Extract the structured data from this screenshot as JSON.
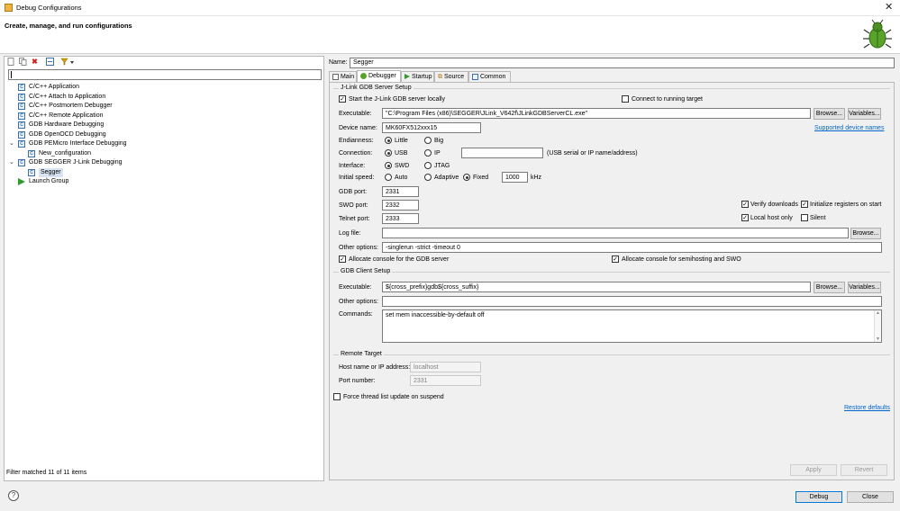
{
  "window": {
    "title": "Debug Configurations",
    "close_icon": "✕"
  },
  "banner": {
    "heading": "Create, manage, and run configurations"
  },
  "left": {
    "toolbar": [
      "new-configuration-icon",
      "duplicate-icon",
      "delete-icon",
      "collapse-all-icon",
      "filter-icon"
    ],
    "filter_value": "",
    "tree": [
      {
        "label": "C/C++ Application",
        "icon": "c"
      },
      {
        "label": "C/C++ Attach to Application",
        "icon": "c"
      },
      {
        "label": "C/C++ Postmortem Debugger",
        "icon": "c"
      },
      {
        "label": "C/C++ Remote Application",
        "icon": "c"
      },
      {
        "label": "GDB Hardware Debugging",
        "icon": "c"
      },
      {
        "label": "GDB OpenOCD Debugging",
        "icon": "c"
      },
      {
        "label": "GDB PEMicro Interface Debugging",
        "icon": "c",
        "expanded": "⌄"
      },
      {
        "label": "New_configuration",
        "icon": "c"
      },
      {
        "label": "GDB SEGGER J-Link Debugging",
        "icon": "c",
        "expanded": "⌄"
      },
      {
        "label": "Segger",
        "icon": "c"
      },
      {
        "label": "Launch Group",
        "icon": "launch"
      }
    ],
    "status": "Filter matched 11 of 11 items"
  },
  "right": {
    "name_label": "Name:",
    "name_value": "Segger",
    "tabs": [
      "Main",
      "Debugger",
      "Startup",
      "Source",
      "Common"
    ],
    "active_tab": "Debugger",
    "server": {
      "title": "J-Link GDB Server Setup",
      "start_locally": "Start the J-Link GDB server locally",
      "connect_running": "Connect to running target",
      "exec_label": "Executable:",
      "exec_value": "\"C:\\Program Files (x86)\\SEGGER\\JLink_V642f\\JLinkGDBServerCL.exe\"",
      "browse": "Browse...",
      "variables": "Variables...",
      "device_label": "Device name:",
      "device_value": "MK60FX512xxx15",
      "supported_link": "Supported device names",
      "endianness_label": "Endianness:",
      "little": "Little",
      "big": "Big",
      "connection_label": "Connection:",
      "usb": "USB",
      "ip": "IP",
      "connection_hint": "(USB serial or IP name/address)",
      "interface_label": "Interface:",
      "swd": "SWD",
      "jtag": "JTAG",
      "speed_label": "Initial speed:",
      "auto": "Auto",
      "adaptive": "Adaptive",
      "fixed": "Fixed",
      "speed_value": "1000",
      "khz": "kHz",
      "gdb_port_label": "GDB port:",
      "gdb_port": "2331",
      "swo_port_label": "SWO port:",
      "swo_port": "2332",
      "telnet_port_label": "Telnet port:",
      "telnet_port": "2333",
      "verify": "Verify downloads",
      "init_regs": "Initialize registers on start",
      "local_only": "Local host only",
      "silent": "Silent",
      "log_label": "Log file:",
      "log_value": "",
      "other_label": "Other options:",
      "other_value": "-singlerun -strict -timeout 0",
      "alloc_gdb": "Allocate console for the GDB server",
      "alloc_semi": "Allocate console for semihosting and SWO"
    },
    "client": {
      "title": "GDB Client Setup",
      "exec_label": "Executable:",
      "exec_value": "${cross_prefix}gdb${cross_suffix}",
      "browse": "Browse...",
      "variables": "Variables...",
      "other_label": "Other options:",
      "other_value": "",
      "commands_label": "Commands:",
      "commands_value": "set mem inaccessible-by-default off"
    },
    "remote": {
      "title": "Remote Target",
      "host_label": "Host name or IP address:",
      "host_value": "localhost",
      "port_label": "Port number:",
      "port_value": "2331"
    },
    "force_thread": "Force thread list update on suspend",
    "restore_defaults": "Restore defaults",
    "apply": "Apply",
    "revert": "Revert"
  },
  "footer": {
    "help": "?",
    "debug": "Debug",
    "close": "Close"
  }
}
